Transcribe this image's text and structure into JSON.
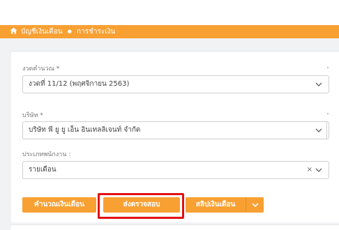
{
  "breadcrumb": {
    "home_icon": "home-icon",
    "items": [
      "บัญชีเงินเดือน",
      "การชำระเงิน"
    ],
    "separator": "●"
  },
  "form": {
    "period": {
      "label": "งวดคำนวณ *",
      "value": "งวดที่ 11/12 (พฤศจิกายน 2563)"
    },
    "company": {
      "label": "บริษัท *",
      "value": "บริษัท พี ยู ยู เอ็น อินเทลลิเจนท์ จำกัด"
    },
    "employee_type": {
      "label": "ประเภทพนักงาน :",
      "value": "รายเดือน",
      "clear": "×"
    }
  },
  "buttons": {
    "calculate": "คำนวณเงินเดือน",
    "submit_review": "ส่งตรวจสอบ",
    "payslip": "สลิปเงินเดือน"
  },
  "colors": {
    "accent": "#f9a033",
    "highlight": "#e01010"
  }
}
